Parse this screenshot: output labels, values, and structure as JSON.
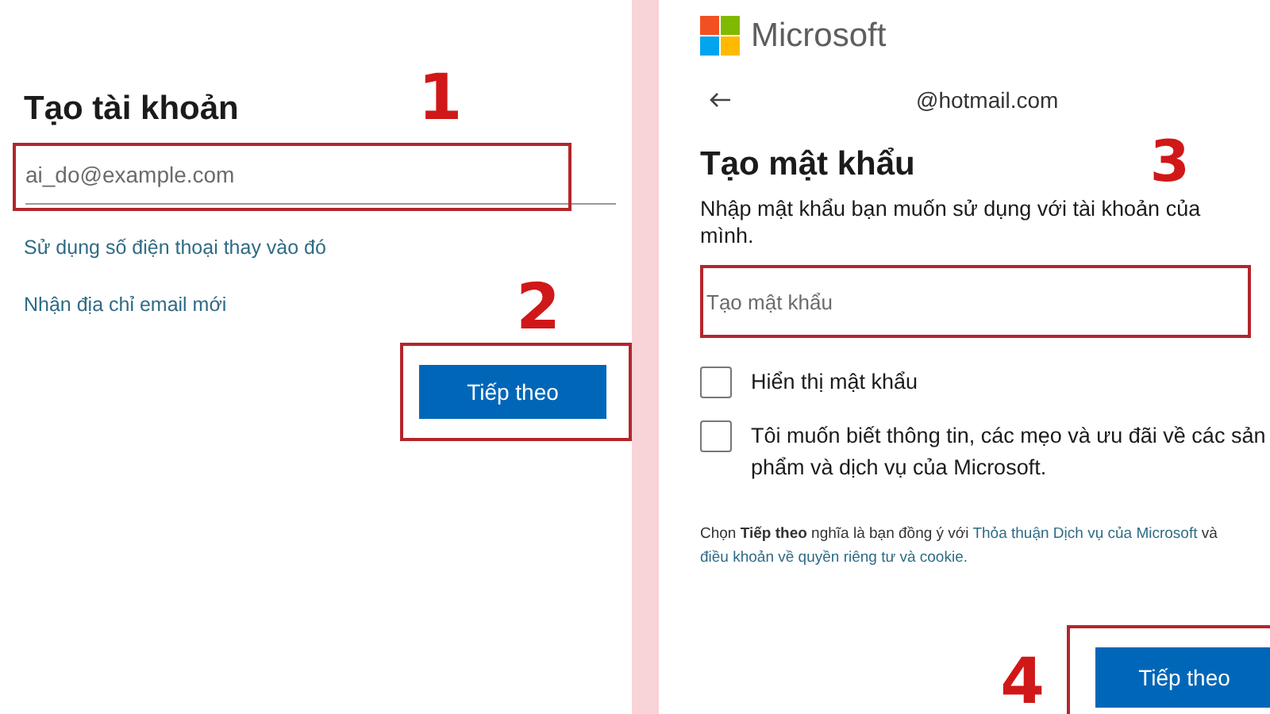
{
  "left": {
    "heading": "Tạo tài khoản",
    "step_email": "1",
    "email_field": {
      "placeholder": "ai_do@example.com"
    },
    "links": [
      "Sử dụng số điện thoại thay vào đó",
      "Nhận địa chỉ email mới"
    ],
    "step_next": "2",
    "next_button": "Tiếp theo"
  },
  "right": {
    "brand": "Microsoft",
    "account": "@hotmail.com",
    "heading": "Tạo mật khẩu",
    "step_password": "3",
    "instruction": "Nhập mật khẩu bạn muốn sử dụng với tài khoản của mình.",
    "password_field": {
      "placeholder": "Tạo mật khẩu"
    },
    "options": [
      {
        "label": "Hiển thị mật khẩu",
        "checked": false
      },
      {
        "label": "Tôi muốn biết thông tin, các mẹo và ưu đãi về các sản phẩm và dịch vụ của Microsoft.",
        "checked": false
      }
    ],
    "terms": {
      "prefix": "Chọn **Tiếp theo** nghĩa là bạn đồng ý với",
      "service_link": "Thỏa thuận Dịch vụ của Microsoft",
      "joiner": "và",
      "privacy_link": "điều khoản về quyền riêng tư và cookie."
    },
    "step_next": "4",
    "next_button": "Tiếp theo"
  }
}
